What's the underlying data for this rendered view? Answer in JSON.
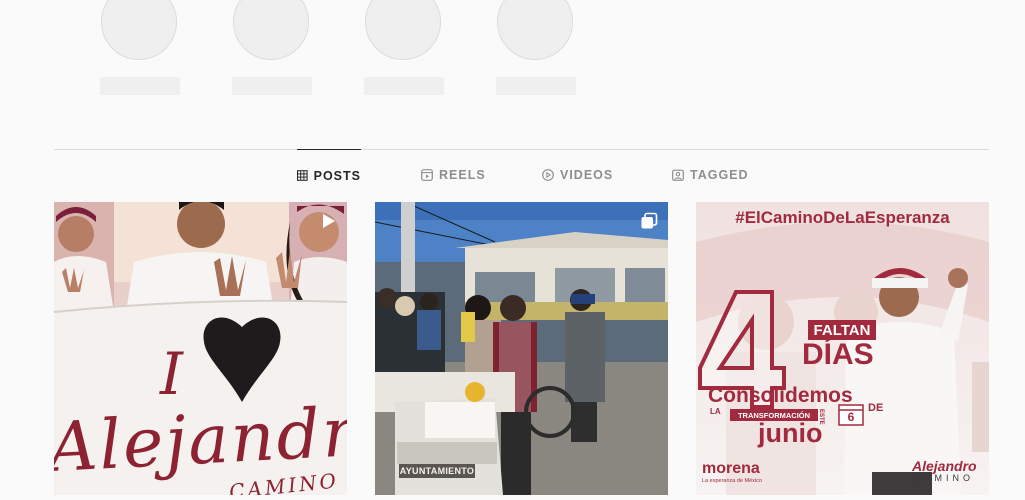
{
  "highlights": [
    {
      "label": ""
    },
    {
      "label": ""
    },
    {
      "label": ""
    },
    {
      "label": ""
    }
  ],
  "tabs": [
    {
      "label": "POSTS",
      "icon": "grid-icon",
      "active": true
    },
    {
      "label": "REELS",
      "icon": "reels-icon",
      "active": false
    },
    {
      "label": "VIDEOS",
      "icon": "play-icon",
      "active": false
    },
    {
      "label": "TAGGED",
      "icon": "tag-icon",
      "active": false
    }
  ],
  "posts": [
    {
      "type": "reel",
      "badge_icon": "reel-icon",
      "banner": {
        "line1": "I",
        "line2": "Alejandro",
        "line3": "CAMINO"
      }
    },
    {
      "type": "carousel",
      "badge_icon": "carousel-icon",
      "box_label": "AYUNTAMIENTO"
    },
    {
      "type": "image",
      "hashtag": "#ElCaminoDeLaEsperanza",
      "big_number": "4",
      "faltan": "FALTAN",
      "dias": "DÍAS",
      "consolidemos": "Consolidemos",
      "la": "LA",
      "transformacion": "TRANSFORMACIÓN",
      "este": "ESTE",
      "date_day": "6",
      "de": "DE",
      "month": "junio",
      "party": "morena",
      "party_sub": "La esperanza de México",
      "candidate_first": "Alejandro",
      "candidate_last": "CAMINO"
    }
  ],
  "colors": {
    "accent_red": "#a12a3f",
    "muted": "#8e8e8e",
    "text": "#262626"
  }
}
